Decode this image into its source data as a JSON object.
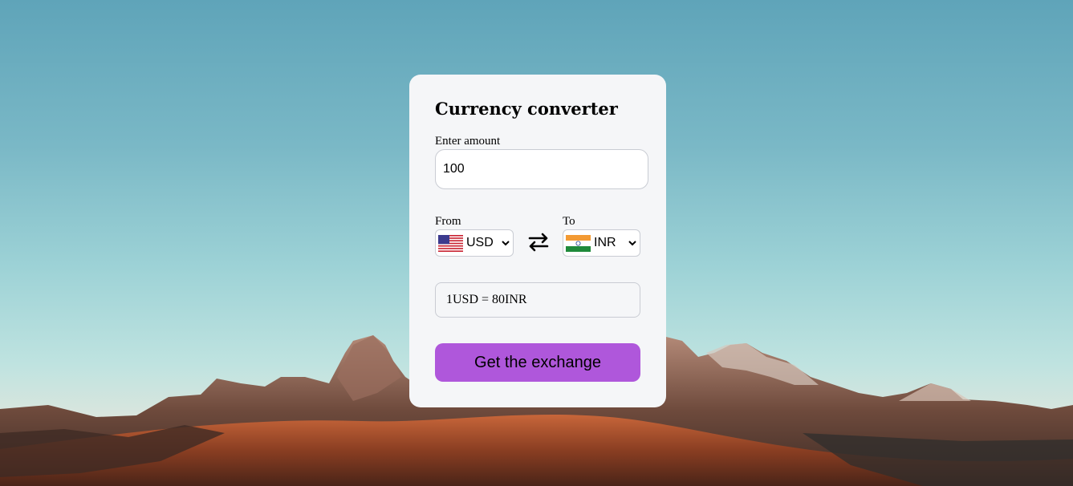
{
  "converter": {
    "title": "Currency converter",
    "amount_label": "Enter amount",
    "amount_value": "100",
    "from_label": "From",
    "to_label": "To",
    "from_currency": {
      "code": "USD",
      "flag_icon": "us-flag-icon"
    },
    "to_currency": {
      "code": "INR",
      "flag_icon": "india-flag-icon"
    },
    "swap_icon": "swap-arrows-icon",
    "exchange_rate_text": "1USD = 80INR",
    "submit_label": "Get the exchange",
    "accent_color": "#af57db"
  }
}
